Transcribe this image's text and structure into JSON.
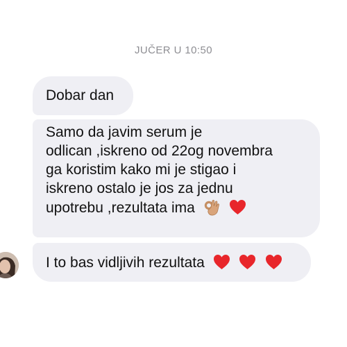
{
  "conversation": {
    "timestamp": "JUČER U 10:50",
    "messages": [
      {
        "text": "Dobar dan"
      },
      {
        "lines": [
          "Samo da javim serum je",
          "odlican ,iskreno od 22og novembra",
          "ga koristim kako mi je stigao i",
          "iskreno ostalo je jos za jednu",
          "upotrebu ,rezultata ima"
        ],
        "emojis": [
          "ok-hand-icon",
          "red-heart-icon"
        ]
      },
      {
        "text": "I to bas vidljivih rezultata",
        "emojis": [
          "red-heart-icon",
          "red-heart-icon",
          "red-heart-icon"
        ]
      }
    ]
  },
  "colors": {
    "bubble_background": "#efeff4",
    "timestamp_text": "#8e8e93",
    "heart": "#e8262b"
  }
}
